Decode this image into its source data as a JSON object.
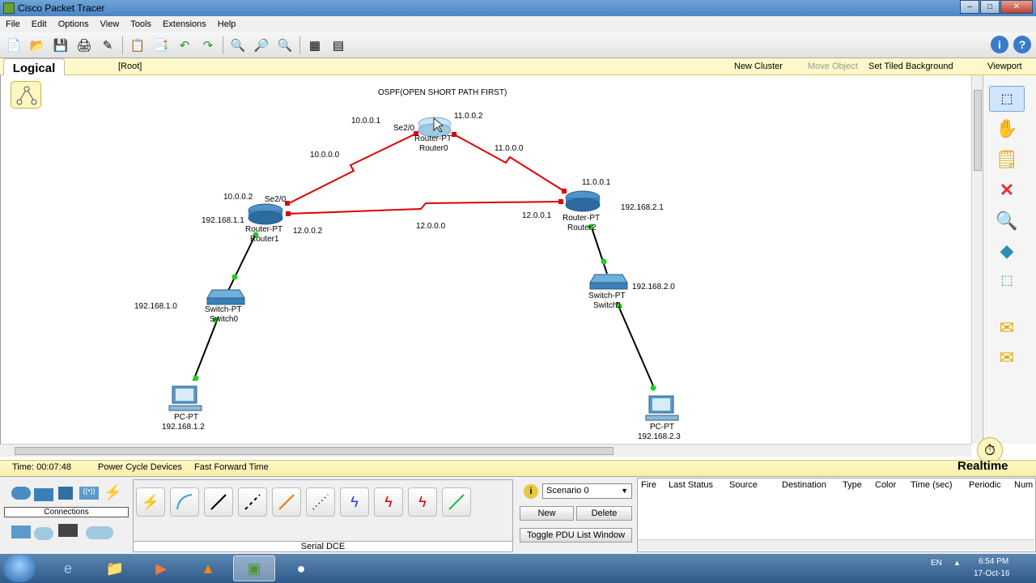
{
  "window": {
    "title": "Cisco Packet Tracer"
  },
  "menu": [
    "File",
    "Edit",
    "Options",
    "View",
    "Tools",
    "Extensions",
    "Help"
  ],
  "nav": {
    "logical_tab": "Logical",
    "root": "[Root]",
    "new_cluster": "New Cluster",
    "move_object": "Move Object",
    "set_tiled_background": "Set Tiled Background",
    "viewport": "Viewport"
  },
  "canvas": {
    "note": "OSPF(OPEN SHORT PATH FIRST)",
    "router0": {
      "type": "Router-PT",
      "name": "Router0",
      "ip_left": "10.0.0.1",
      "port_left": "Se2/0",
      "ip_right": "11.0.0.2"
    },
    "router1": {
      "type": "Router-PT",
      "name": "Router1",
      "ip_top": "10.0.0.2",
      "port_top": "Se2/0",
      "ip_lan": "192.168.1.1",
      "ip_right": "12.0.0.2"
    },
    "router2": {
      "type": "Router-PT",
      "name": "Router2",
      "ip_top": "11.0.0.1",
      "ip_left": "12.0.0.1",
      "ip_lan": "192.168.2.1"
    },
    "switch0": {
      "type": "Switch-PT",
      "name": "Switch0",
      "net": "192.168.1.0"
    },
    "switch1": {
      "type": "Switch-PT",
      "name": "Switch1",
      "net": "192.168.2.0"
    },
    "pc0": {
      "type": "PC-PT",
      "ip": "192.168.1.2"
    },
    "pc1": {
      "type": "PC-PT",
      "ip": "192.168.2.3"
    },
    "link_10": "10.0.0.0",
    "link_11": "11.0.0.0",
    "link_12": "12.0.0.0"
  },
  "status": {
    "time": "Time: 00:07:48",
    "power_cycle": "Power Cycle Devices",
    "fast_forward": "Fast Forward Time",
    "mode": "Realtime"
  },
  "bottom": {
    "connections_label": "Connections",
    "cable_label": "Serial DCE",
    "scenario": "Scenario 0",
    "new_button": "New",
    "delete_button": "Delete",
    "toggle_button": "Toggle PDU List Window",
    "pdu_columns": [
      "Fire",
      "Last Status",
      "Source",
      "Destination",
      "Type",
      "Color",
      "Time (sec)",
      "Periodic",
      "Num"
    ]
  },
  "taskbar": {
    "lang": "EN",
    "time": "6:54 PM",
    "date": "17-Oct-16"
  },
  "colors": {
    "serial_link": "#e00000",
    "ethernet_link": "#000000",
    "link_up": "#22cc22",
    "router_blue": "#3b7fb8"
  }
}
